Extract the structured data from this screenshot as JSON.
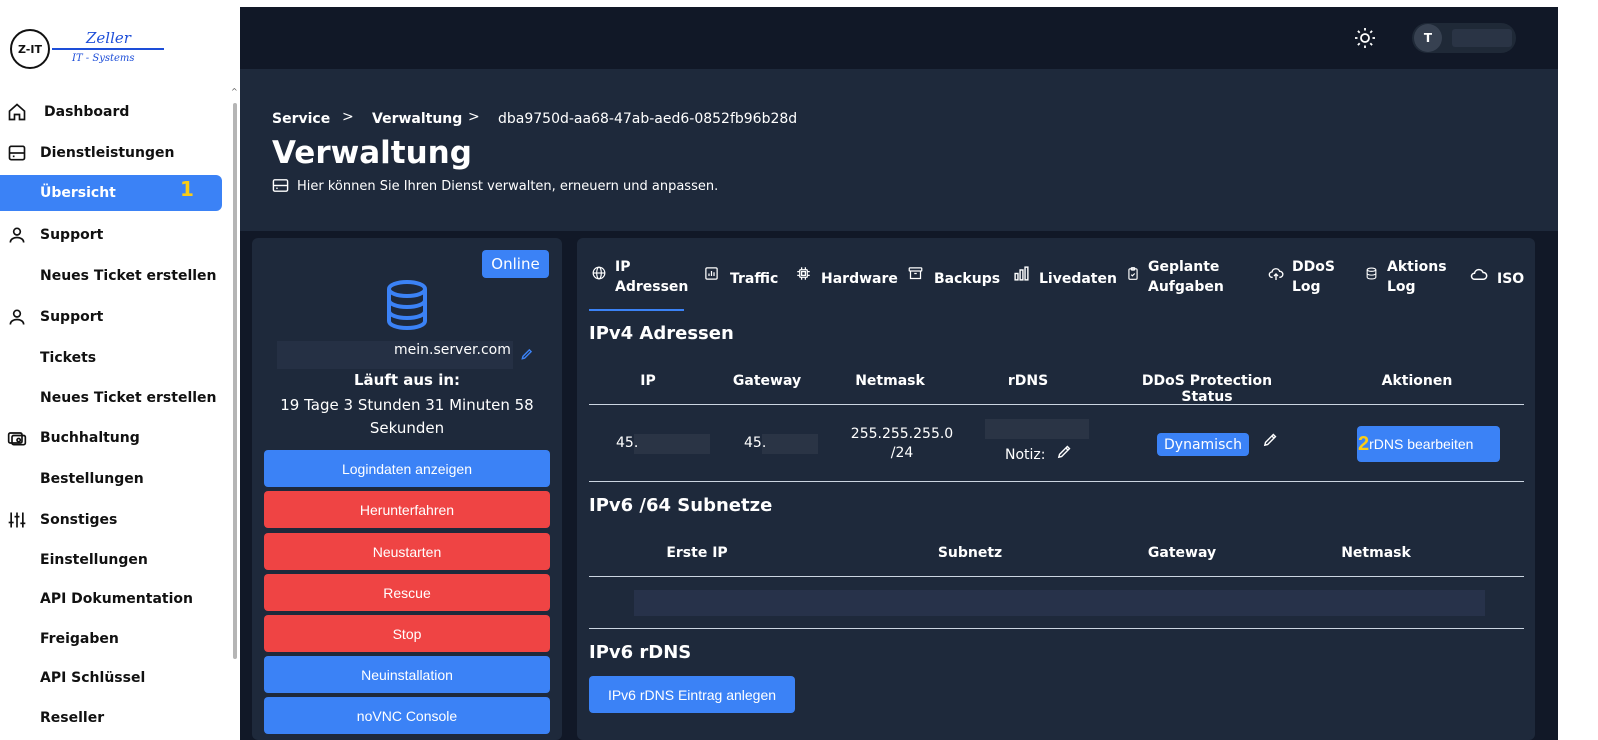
{
  "brand": {
    "logo_mark": "Z-IT",
    "name": "Zeller",
    "subtitle": "IT - Systems"
  },
  "sidebar": {
    "items": [
      {
        "label": "Dashboard",
        "icon": "home-icon"
      },
      {
        "label": "Dienstleistungen",
        "icon": "server-icon"
      },
      {
        "label": "Übersicht",
        "active": true,
        "marker": "1"
      },
      {
        "label": "Support",
        "icon": "user-icon"
      },
      {
        "label": "Neues Ticket erstellen"
      },
      {
        "label": "Support",
        "icon": "user-icon"
      },
      {
        "label": "Tickets"
      },
      {
        "label": "Neues Ticket erstellen"
      },
      {
        "label": "Buchhaltung",
        "icon": "money-icon"
      },
      {
        "label": "Bestellungen"
      },
      {
        "label": "Sonstiges",
        "icon": "sliders-icon"
      },
      {
        "label": "Einstellungen"
      },
      {
        "label": "API Dokumentation"
      },
      {
        "label": "Freigaben"
      },
      {
        "label": "API Schlüssel"
      },
      {
        "label": "Reseller"
      }
    ]
  },
  "topbar": {
    "avatar_initial": "T"
  },
  "breadcrumb": {
    "items": [
      "Service",
      "Verwaltung",
      "dba9750d-aa68-47ab-aed6-0852fb96b28d"
    ],
    "separator": ">"
  },
  "page": {
    "title": "Verwaltung",
    "description": "Hier können Sie Ihren Dienst verwalten, erneuern und anpassen."
  },
  "server": {
    "status": "Online",
    "hostname": "mein.server.com",
    "expire_label": "Läuft aus in:",
    "expire_value": "19 Tage 3 Stunden 31 Minuten 58 Sekunden",
    "buttons": [
      {
        "label": "Logindaten anzeigen",
        "color": "#3b82f6"
      },
      {
        "label": "Herunterfahren",
        "color": "#ef4444"
      },
      {
        "label": "Neustarten",
        "color": "#ef4444"
      },
      {
        "label": "Rescue",
        "color": "#ef4444"
      },
      {
        "label": "Stop",
        "color": "#ef4444"
      },
      {
        "label": "Neuinstallation",
        "color": "#3b82f6"
      },
      {
        "label": "noVNC Console",
        "color": "#3b82f6"
      }
    ]
  },
  "tabs": [
    {
      "line1": "IP",
      "line2": "Adressen",
      "icon": "globe-icon",
      "active": true
    },
    {
      "line1": "Traffic",
      "icon": "chart-icon"
    },
    {
      "line1": "Hardware",
      "icon": "cpu-icon"
    },
    {
      "line1": "Backups",
      "icon": "archive-icon"
    },
    {
      "line1": "Livedaten",
      "icon": "bar-chart-icon"
    },
    {
      "line1": "Geplante",
      "line2": "Aufgaben",
      "icon": "clipboard-icon"
    },
    {
      "line1": "DDoS",
      "line2": "Log",
      "icon": "cloud-upload-icon"
    },
    {
      "line1": "Aktions",
      "line2": "Log",
      "icon": "database-icon"
    },
    {
      "line1": "ISO",
      "icon": "cloud-icon"
    }
  ],
  "ipv4": {
    "title": "IPv4 Adressen",
    "columns": [
      "IP",
      "Gateway",
      "Netmask",
      "rDNS",
      "DDoS Protection Status",
      "Aktionen"
    ],
    "row": {
      "ip": "45.",
      "gateway": "45.",
      "netmask_line1": "255.255.255.0",
      "netmask_line2": "/24",
      "note_label": "Notiz:",
      "ddos_status": "Dynamisch",
      "action_marker": "2",
      "action_label": "rDNS bearbeiten"
    }
  },
  "ipv6": {
    "title": "IPv6 /64 Subnetze",
    "columns": [
      "Erste IP",
      "Subnetz",
      "Gateway",
      "Netmask"
    ]
  },
  "ipv6_rdns": {
    "title": "IPv6 rDNS",
    "button_label": "IPv6 rDNS Eintrag anlegen"
  },
  "colors": {
    "accent": "#3b82f6",
    "danger": "#ef4444",
    "marker": "#facc15",
    "panel": "#1e293b",
    "background": "#111827"
  }
}
